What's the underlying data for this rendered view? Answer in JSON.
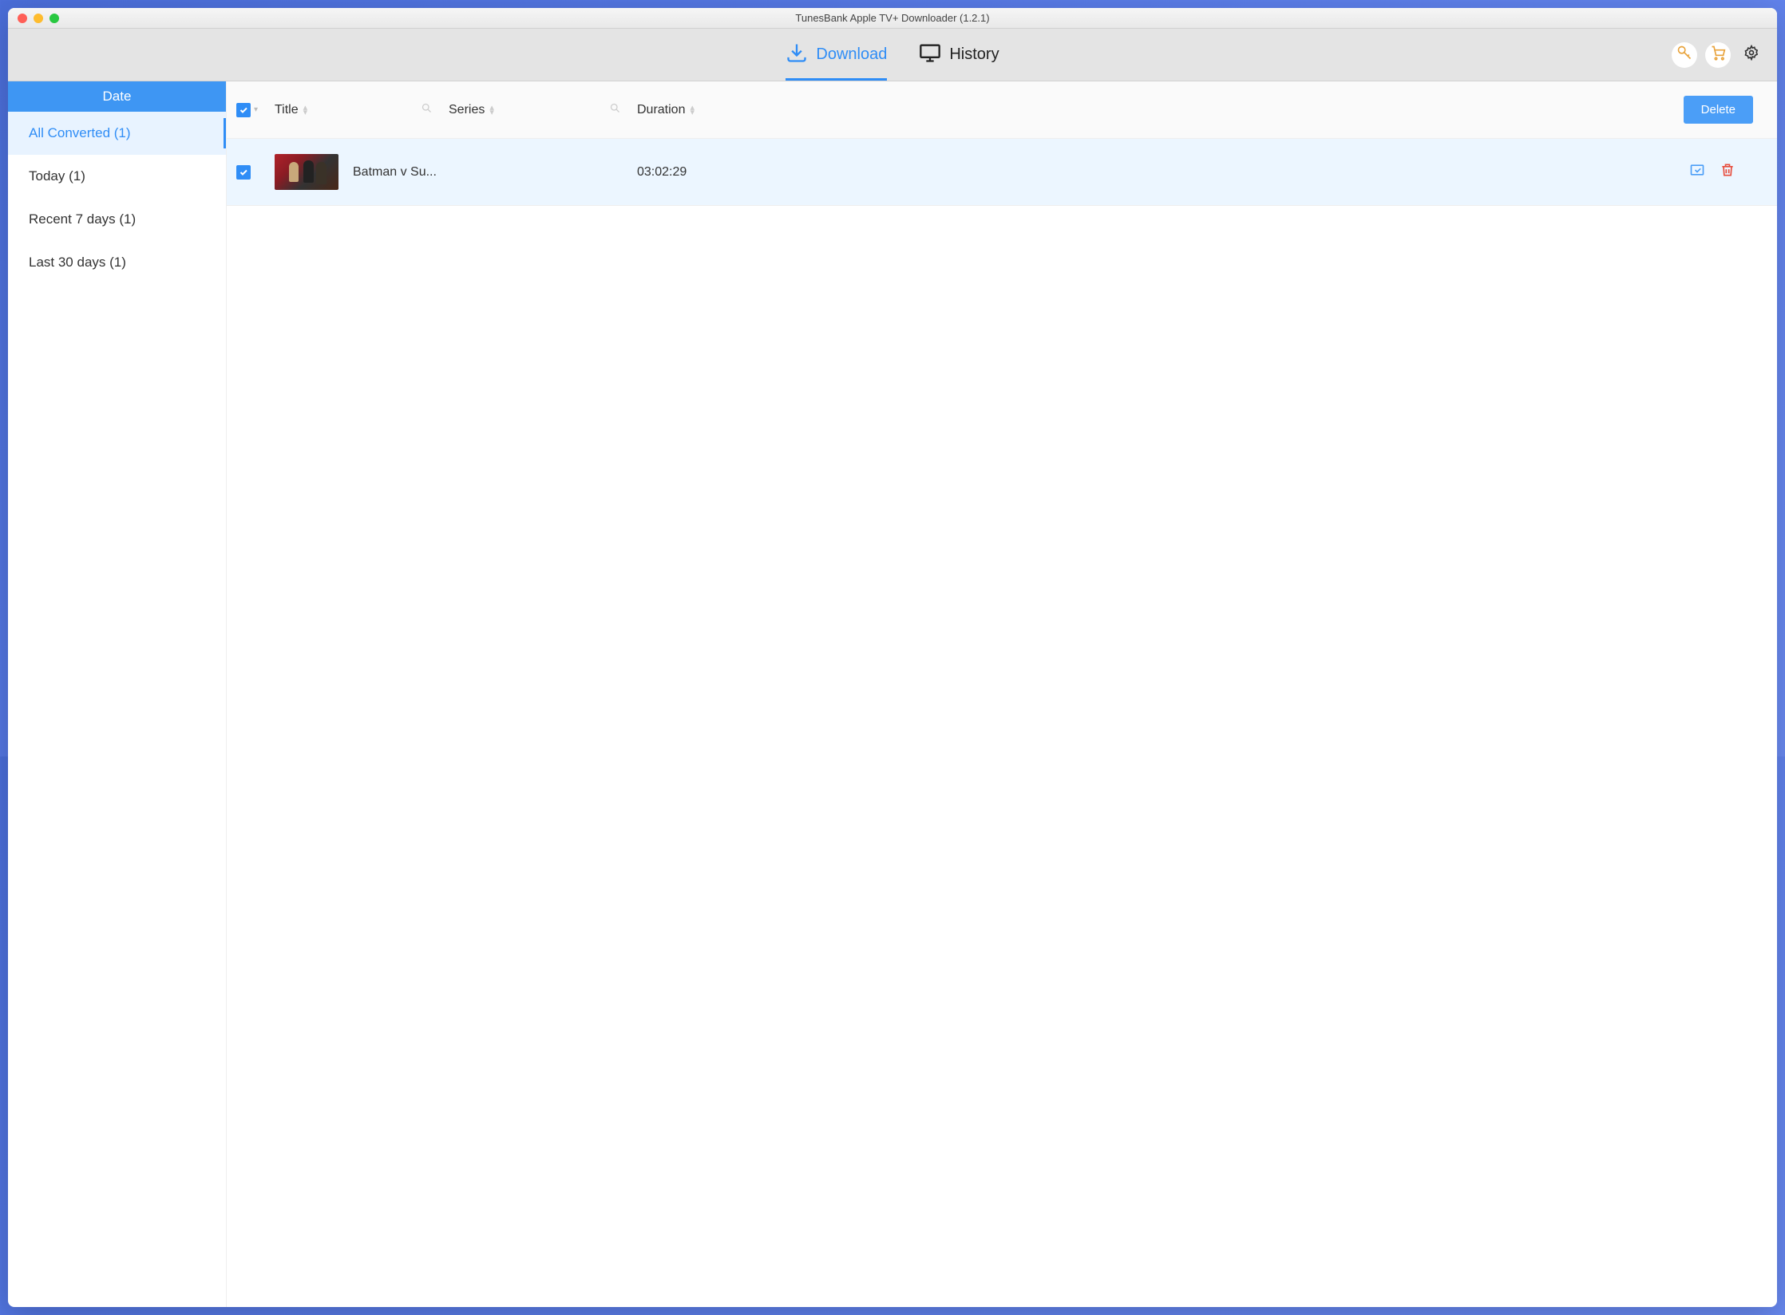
{
  "window": {
    "title": "TunesBank Apple TV+ Downloader (1.2.1)"
  },
  "toolbar": {
    "tabs": {
      "download": "Download",
      "history": "History"
    }
  },
  "sidebar": {
    "header": "Date",
    "items": [
      {
        "label": "All Converted (1)"
      },
      {
        "label": "Today (1)"
      },
      {
        "label": "Recent 7 days (1)"
      },
      {
        "label": "Last 30 days (1)"
      }
    ]
  },
  "table": {
    "columns": {
      "title": "Title",
      "series": "Series",
      "duration": "Duration"
    },
    "delete_button": "Delete",
    "rows": [
      {
        "title": "Batman v Su...",
        "series": "",
        "duration": "03:02:29"
      }
    ]
  }
}
